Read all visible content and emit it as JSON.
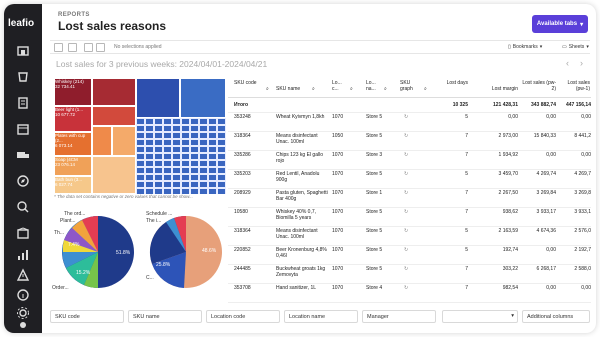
{
  "app": {
    "logo": "leafio"
  },
  "header": {
    "breadcrumb": "REPORTS",
    "title": "Lost sales reasons",
    "available_tabs": "Available tabs"
  },
  "toolbar": {
    "no_selections": "No selections applied",
    "bookmarks": "Bookmarks",
    "sheets": "Sheets"
  },
  "sheet": {
    "title": "Lost sales for 3 previous weeks: 2024/04/01-2024/04/21"
  },
  "treemap": {
    "labels": [
      {
        "text": "Whiskey (214)\n32 734.41"
      },
      {
        "text": "Beer light (1...\n10 677.72"
      },
      {
        "text": "Plates with cup (2...\n6 073.14"
      },
      {
        "text": "Soap (4CM\n 23 076.14"
      },
      {
        "text": "Bath bun (3...\n6 027.74"
      }
    ],
    "note": "* The data set contains negative or zero values that cannot be show..."
  },
  "pie_left": {
    "labels": [
      "The ord...",
      "Plant...",
      "Th...",
      "Order..."
    ],
    "values": [
      "51.8%",
      "15.2%",
      "7.4%"
    ]
  },
  "pie_right": {
    "labels": [
      "Schedule ...",
      "The i...",
      "C..."
    ],
    "values": [
      "25.8%",
      "48.6%"
    ]
  },
  "table": {
    "headers": [
      "SKU code",
      "SKU name",
      "Lo... c...",
      "Lo... na...",
      "SKU graph",
      "Lost days",
      "Lost margin",
      "Lost sales (pw-2)",
      "Lost sales (pw-1)"
    ],
    "totals": {
      "label": "Итого",
      "days": "10 325",
      "margin": "121 428,31",
      "pw2": "343 882,74",
      "pw1": "447 156,14"
    },
    "rows": [
      {
        "code": "353248",
        "name": "Wheat Kyivmyn 1,8kh",
        "loc": "1070",
        "store": "Store 5",
        "days": "5",
        "margin": "0,00",
        "pw2": "0,00",
        "pw1": "0,00"
      },
      {
        "code": "318364",
        "name": "Means disinfectant Unac. 100ml",
        "loc": "1050",
        "store": "Store 5",
        "days": "7",
        "margin": "2 973,00",
        "pw2": "15 840,33",
        "pw1": "8 441,2"
      },
      {
        "code": "335286",
        "name": "Chips 123 kg El gallo rojo",
        "loc": "1070",
        "store": "Store 3",
        "days": "7",
        "margin": "1 934,92",
        "pw2": "0,00",
        "pw1": "0,00"
      },
      {
        "code": "335203",
        "name": "Red Lentil, Anadolu 900g",
        "loc": "1070",
        "store": "Store 5",
        "days": "5",
        "margin": "3 459,70",
        "pw2": "4 269,74",
        "pw1": "4 269,7"
      },
      {
        "code": "208929",
        "name": "Pasta gluten, Spaghetti Bar 400g",
        "loc": "1070",
        "store": "Store 1",
        "days": "7",
        "margin": "2 267,50",
        "pw2": "3 269,84",
        "pw1": "3 269,8"
      },
      {
        "code": "10580",
        "name": "Whiskey 40% 0,7, Biomilla 5 years",
        "loc": "1070",
        "store": "Store 5",
        "days": "7",
        "margin": "938,62",
        "pw2": "3 933,17",
        "pw1": "3 933,1"
      },
      {
        "code": "318364",
        "name": "Means disinfectant Unac. 100ml",
        "loc": "1070",
        "store": "Store 5",
        "days": "5",
        "margin": "2 163,59",
        "pw2": "4 674,36",
        "pw1": "2 576,0"
      },
      {
        "code": "220852",
        "name": "Beer Kronenburg 4,8% 0,46l",
        "loc": "1070",
        "store": "Store 5",
        "days": "5",
        "margin": "192,74",
        "pw2": "0,00",
        "pw1": "2 192,7"
      },
      {
        "code": "244485",
        "name": "Buckwheat groats 1kg Zemovyta",
        "loc": "1070",
        "store": "Store 5",
        "days": "7",
        "margin": "303,22",
        "pw2": "6 268,17",
        "pw1": "2 588,0"
      },
      {
        "code": "353708",
        "name": "Hand sanitizer, 1L",
        "loc": "1070",
        "store": "Store 4",
        "days": "7",
        "margin": "982,54",
        "pw2": "0,00",
        "pw1": "0,00"
      },
      {
        "code": "353209",
        "name": "Bulgur, Anadolu, 1kg",
        "loc": "1070",
        "store": "Store 4",
        "days": "7",
        "margin": "2 373,86",
        "pw2": "5 551,49",
        "pw1": "5 551,49"
      }
    ]
  },
  "filters": [
    "SKU code",
    "SKU name",
    "Location code",
    "Location name",
    "Manager",
    "",
    "Additional columns"
  ]
}
